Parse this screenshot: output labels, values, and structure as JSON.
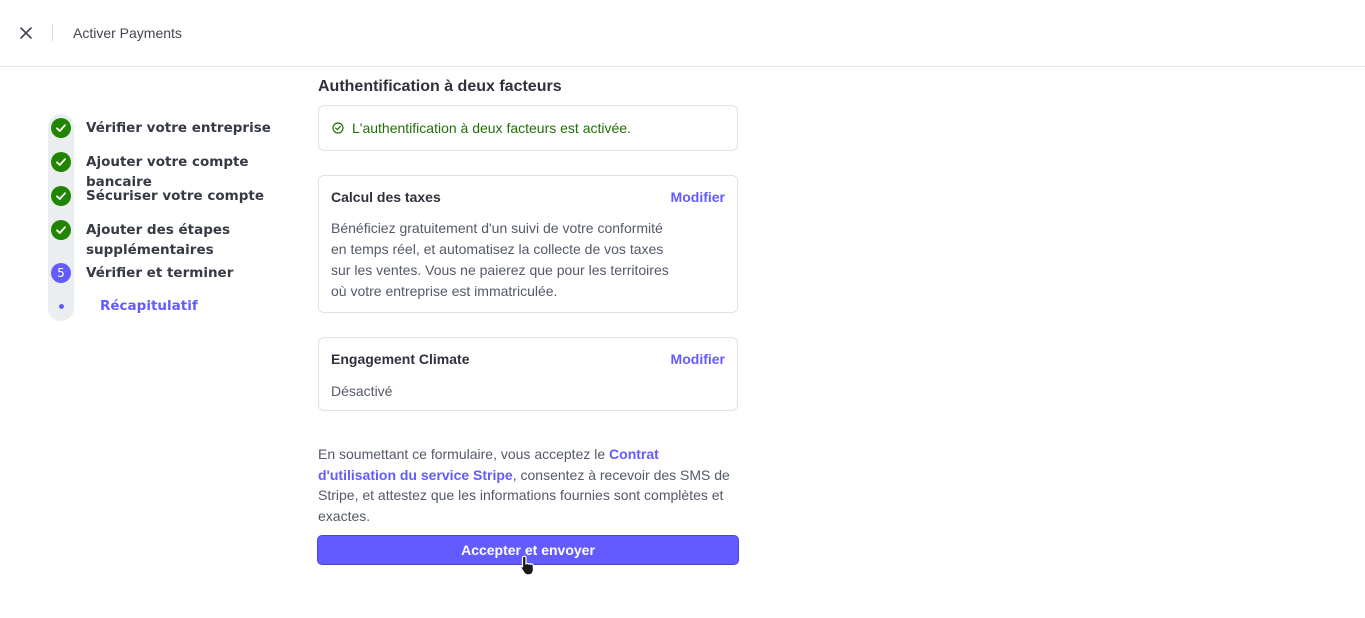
{
  "header": {
    "title": "Activer Payments"
  },
  "stepper": {
    "steps": [
      {
        "label": "Vérifier votre entreprise",
        "status": "done"
      },
      {
        "label": "Ajouter votre compte bancaire",
        "status": "done"
      },
      {
        "label": "Sécuriser votre compte",
        "status": "done"
      },
      {
        "label": "Ajouter des étapes supplémentaires",
        "status": "done"
      },
      {
        "label": "Vérifier et terminer",
        "status": "current",
        "number": "5"
      }
    ],
    "substep": {
      "label": "Récapitulatif"
    }
  },
  "main": {
    "section_title": "Authentification à deux facteurs",
    "two_factor_status": "L'authentification à deux facteurs est activée.",
    "tax_card": {
      "title": "Calcul des taxes",
      "action": "Modifier",
      "description": "Bénéficiez gratuitement d'un suivi de votre conformité en temps réel, et automatisez la collecte de vos taxes sur les ventes. Vous ne paierez que pour les territoires où votre entreprise est immatriculée."
    },
    "climate_card": {
      "title": "Engagement Climate",
      "action": "Modifier",
      "value": "Désactivé"
    },
    "legal": {
      "prefix": "En soumettant ce formulaire, vous acceptez le ",
      "link": "Contrat d'utilisation du service Stripe",
      "suffix": ", consentez à recevoir des SMS de Stripe, et attestez que les informations fournies sont complètes et exactes."
    },
    "submit_label": "Accepter et envoyer"
  },
  "colors": {
    "accent": "#635bff",
    "success": "#228403",
    "success_text": "#217005"
  },
  "icons": [
    "close-icon",
    "check-icon",
    "check-circle-icon",
    "pointer-cursor-icon"
  ]
}
